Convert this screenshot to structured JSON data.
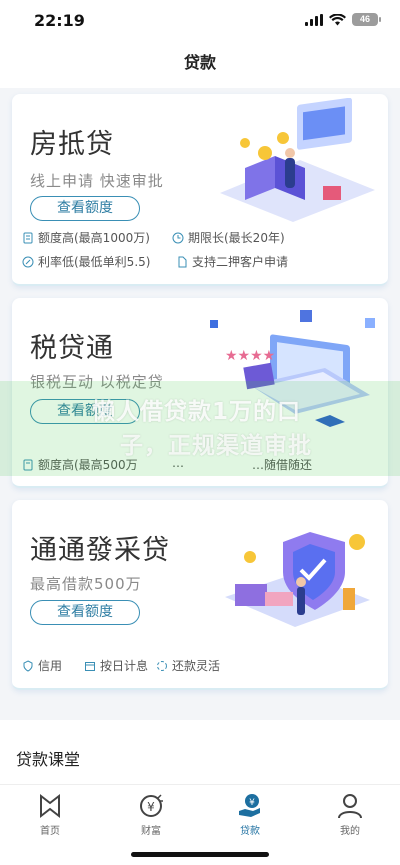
{
  "status": {
    "time": "22:19",
    "battery": "46"
  },
  "nav": {
    "title": "贷款"
  },
  "cards": [
    {
      "title": "房抵贷",
      "subtitle": "线上申请 快速审批",
      "button": "查看额度",
      "features": [
        "额度高(最高1000万)",
        "期限长(最长20年)",
        "利率低(最低单利5.5)",
        "支持二押客户申请"
      ]
    },
    {
      "title": "税贷通",
      "subtitle": "银税互动 以税定贷",
      "button": "查看额度",
      "features": [
        "额度高(最高500万",
        "…",
        "…随借随还"
      ]
    },
    {
      "title": "通通發采贷",
      "subtitle": "最高借款500万",
      "button": "查看额度",
      "features": [
        "信用",
        "按日计息",
        "还款灵活"
      ]
    }
  ],
  "overlay": {
    "line1": "懒人借贷款1万的口",
    "line2": "子，正规渠道审批"
  },
  "section": {
    "title": "贷款课堂"
  },
  "tabs": [
    {
      "label": "首页",
      "icon": "home-icon"
    },
    {
      "label": "财富",
      "icon": "wealth-icon"
    },
    {
      "label": "贷款",
      "icon": "loan-icon"
    },
    {
      "label": "我的",
      "icon": "profile-icon"
    }
  ],
  "colors": {
    "accent": "#2f7ea3",
    "active_tab": "#1d6fa0",
    "card_border": "#d9ecf3"
  }
}
